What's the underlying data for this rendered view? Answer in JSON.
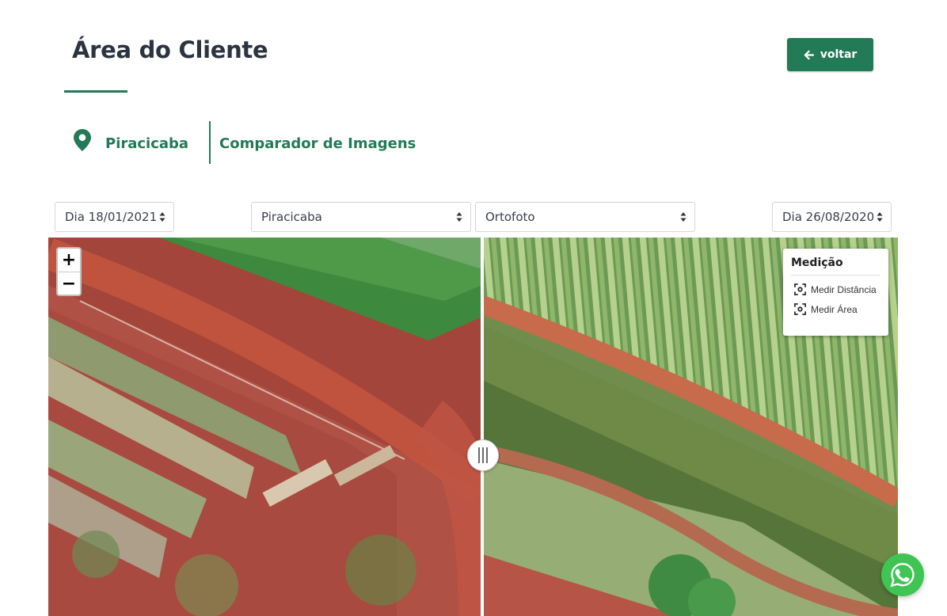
{
  "header": {
    "title": "Área do Cliente",
    "back_label": "voltar"
  },
  "breadcrumb": {
    "location": "Piracicaba",
    "section": "Comparador de Imagens"
  },
  "filters": {
    "date_left": "Dia 18/01/2021",
    "location": "Piracicaba",
    "layer": "Ortofoto",
    "date_right": "Dia 26/08/2020"
  },
  "map": {
    "zoom_in": "+",
    "zoom_out": "−",
    "measure": {
      "title": "Medição",
      "distance_label": "Medir Distância",
      "area_label": "Medir Área"
    }
  },
  "colors": {
    "brand": "#237a57",
    "whatsapp": "#3ec553"
  },
  "icons": {
    "location": "map-pin-icon",
    "back": "arrow-left-icon",
    "whatsapp": "whatsapp-icon",
    "measure": "focus-target-icon"
  }
}
